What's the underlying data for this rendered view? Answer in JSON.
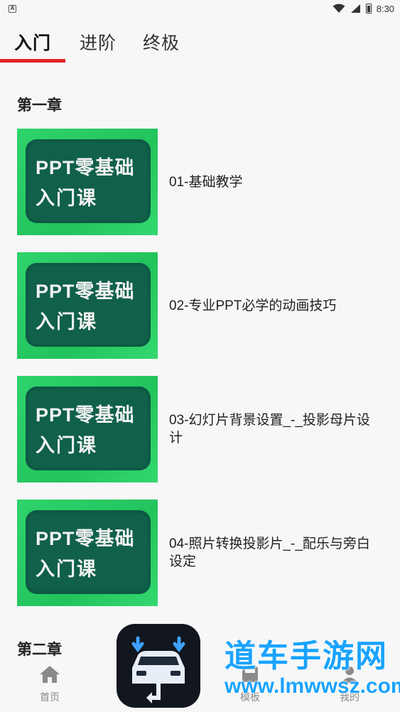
{
  "status": {
    "time": "8:30",
    "notification_badge": "A"
  },
  "tabs": [
    {
      "label": "入门",
      "active": true
    },
    {
      "label": "进阶",
      "active": false
    },
    {
      "label": "终极",
      "active": false
    }
  ],
  "accent_color": "#e02424",
  "chapters": [
    {
      "title": "第一章",
      "lessons": [
        {
          "thumb_line1": "PPT零基础",
          "thumb_line2": "入门课",
          "title": "01-基础教学"
        },
        {
          "thumb_line1": "PPT零基础",
          "thumb_line2": "入门课",
          "title": "02-专业PPT必学的动画技巧"
        },
        {
          "thumb_line1": "PPT零基础",
          "thumb_line2": "入门课",
          "title": "03-幻灯片背景设置_-_投影母片设计"
        },
        {
          "thumb_line1": "PPT零基础",
          "thumb_line2": "入门课",
          "title": "04-照片转换投影片_-_配乐与旁白设定"
        }
      ]
    },
    {
      "title": "第二章"
    }
  ],
  "bottom_nav": [
    {
      "label": "首页",
      "icon": "home-icon"
    },
    {
      "label": "模板",
      "icon": "template-icon"
    },
    {
      "label": "我的",
      "icon": "user-icon"
    }
  ],
  "watermark": {
    "name": "道车手游网",
    "url": "www.lmwwsz.com"
  }
}
